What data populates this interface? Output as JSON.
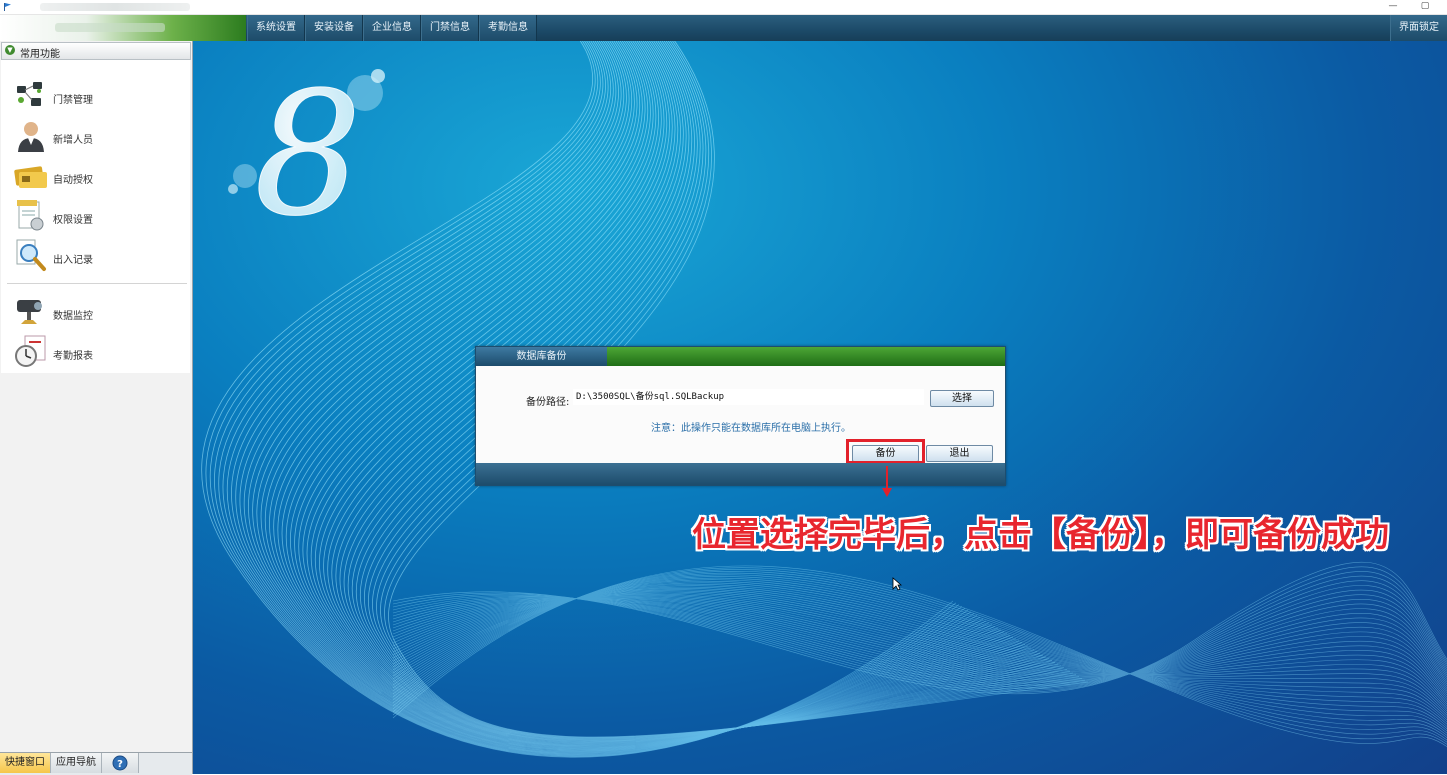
{
  "window": {
    "minimize_glyph": "—",
    "maximize_glyph": "▢"
  },
  "menubar": {
    "items": [
      "系统设置",
      "安装设备",
      "企业信息",
      "门禁信息",
      "考勤信息"
    ],
    "lock_label": "界面锁定"
  },
  "sidebar": {
    "header": "常用功能",
    "toggle_glyph": "▼",
    "items": [
      {
        "label": "门禁管理",
        "icon": "door-control-icon"
      },
      {
        "label": "新增人员",
        "icon": "person-icon"
      },
      {
        "label": "自动授权",
        "icon": "card-icon"
      },
      {
        "label": "权限设置",
        "icon": "permission-doc-icon"
      },
      {
        "label": "出入记录",
        "icon": "magnifier-icon"
      },
      {
        "label": "数据监控",
        "icon": "camera-icon"
      },
      {
        "label": "考勤报表",
        "icon": "clock-icon"
      }
    ],
    "bottom_tabs": [
      "快捷窗口",
      "应用导航"
    ],
    "help_glyph": "?"
  },
  "dialog": {
    "title": "数据库备份",
    "path_label": "备份路径:",
    "path_value": "D:\\3500SQL\\备份sql.SQLBackup",
    "select_button": "选择",
    "note": "注意：此操作只能在数据库所在电脑上执行。",
    "backup_button": "备份",
    "exit_button": "退出"
  },
  "annotation": {
    "caption": "位置选择完毕后，点击【备份】，即可备份成功",
    "color": "#e8262e"
  },
  "desktop": {
    "logo_glyph": "8"
  }
}
